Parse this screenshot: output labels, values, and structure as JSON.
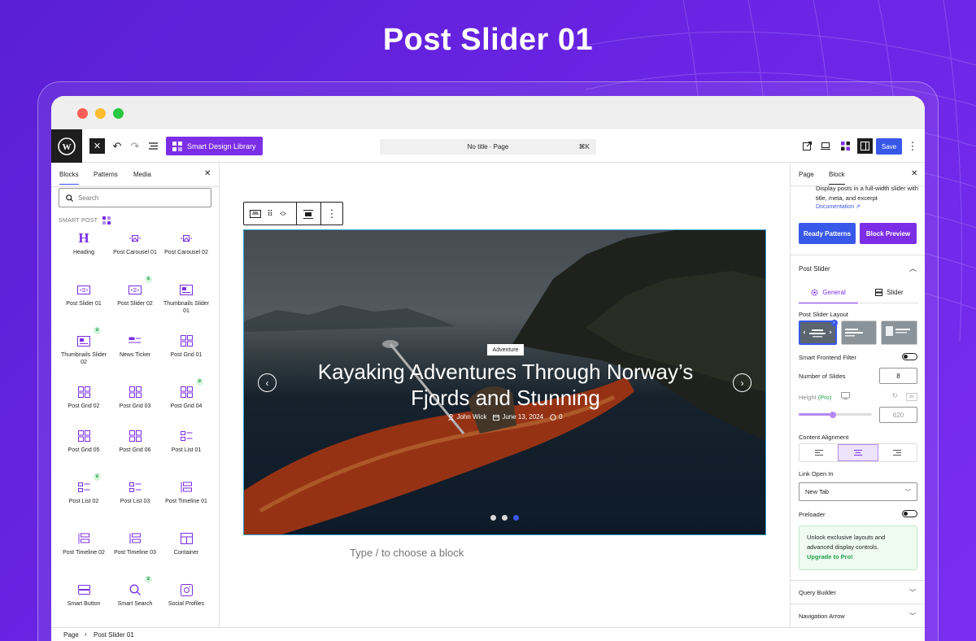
{
  "banner": {
    "title": "Post Slider 01"
  },
  "toolbar": {
    "smart_design_library": "Smart Design Library",
    "command_title": "No title · Page",
    "command_shortcut": "⌘K",
    "save_label": "Save"
  },
  "left_panel": {
    "tabs": [
      "Blocks",
      "Patterns",
      "Media"
    ],
    "search_placeholder": "Search",
    "section_label": "SMART POST",
    "blocks": [
      {
        "label": "Heading",
        "icon": "heading-icon",
        "pro": false
      },
      {
        "label": "Post Carousel 01",
        "icon": "carousel-icon",
        "pro": false
      },
      {
        "label": "Post Carousel 02",
        "icon": "carousel-icon",
        "pro": false
      },
      {
        "label": "Post Slider 01",
        "icon": "slider-icon",
        "pro": false
      },
      {
        "label": "Post Slider 02",
        "icon": "slider-icon",
        "pro": true
      },
      {
        "label": "Thumbnails Slider 01",
        "icon": "thumbnail-slider-icon",
        "pro": false
      },
      {
        "label": "Thumbnails Slider 02",
        "icon": "thumbnail-slider-icon",
        "pro": true
      },
      {
        "label": "News Ticker",
        "icon": "news-ticker-icon",
        "pro": false
      },
      {
        "label": "Post Grid 01",
        "icon": "grid-icon",
        "pro": false
      },
      {
        "label": "Post Grid 02",
        "icon": "grid-icon",
        "pro": false
      },
      {
        "label": "Post Grid 03",
        "icon": "grid-icon",
        "pro": false
      },
      {
        "label": "Post Grid 04",
        "icon": "grid-icon",
        "pro": true
      },
      {
        "label": "Post Grid 05",
        "icon": "grid-icon",
        "pro": false
      },
      {
        "label": "Post Grid 06",
        "icon": "grid-icon",
        "pro": false
      },
      {
        "label": "Post List 01",
        "icon": "list-icon",
        "pro": false
      },
      {
        "label": "Post List 02",
        "icon": "list-icon",
        "pro": true
      },
      {
        "label": "Post List 03",
        "icon": "list-icon",
        "pro": false
      },
      {
        "label": "Post Timeline 01",
        "icon": "timeline-icon",
        "pro": false
      },
      {
        "label": "Post Timeline 02",
        "icon": "timeline-icon",
        "pro": false
      },
      {
        "label": "Post Timeline 03",
        "icon": "timeline-icon",
        "pro": false
      },
      {
        "label": "Container",
        "icon": "container-icon",
        "pro": false
      },
      {
        "label": "Smart Button",
        "icon": "button-icon",
        "pro": false
      },
      {
        "label": "Smart Search",
        "icon": "search-icon",
        "pro": true
      },
      {
        "label": "Social Profiles",
        "icon": "social-icon",
        "pro": false
      }
    ]
  },
  "slide": {
    "category": "Adventure",
    "title": "Kayaking Adventures Through Norway’s Fjords and Stunning",
    "author": "John Wick",
    "date": "June 13, 2024",
    "comments": "0",
    "active_dot": 2,
    "dot_count": 3
  },
  "canvas": {
    "placeholder": "Type / to choose a block"
  },
  "right_panel": {
    "tabs": [
      "Page",
      "Block"
    ],
    "description": "Display posts in a full-width slider with title, meta, and excerpt",
    "doc_link": "Documentation ↗",
    "ready_patterns": "Ready Patterns",
    "block_preview": "Block Preview",
    "section_title": "Post Slider",
    "subtab_general": "General",
    "subtab_slider": "Slider",
    "layout_label": "Post Slider Layout",
    "smart_filter": "Smart Frontend Filter",
    "num_slides_label": "Number of Slides",
    "num_slides": "8",
    "height_label": "Height",
    "height_pro": "(Pro)",
    "height_value": "620",
    "height_fraction": 0.47,
    "content_alignment": "Content Alignment",
    "link_open_label": "Link Open In",
    "link_open_value": "New Tab",
    "preloader": "Preloader",
    "upgrade_text": "Unlock exclusive layouts and advanced display controls.",
    "upgrade_link": "Upgrade to Pro!",
    "query_builder": "Query Builder",
    "navigation_arrow": "Navigation Arrow"
  },
  "footer": {
    "crumb_root": "Page",
    "crumb_current": "Post Slider 01"
  },
  "colors": {
    "accent": "#7b2ee6",
    "save": "#3858e9",
    "pro_green": "#22a04a"
  }
}
